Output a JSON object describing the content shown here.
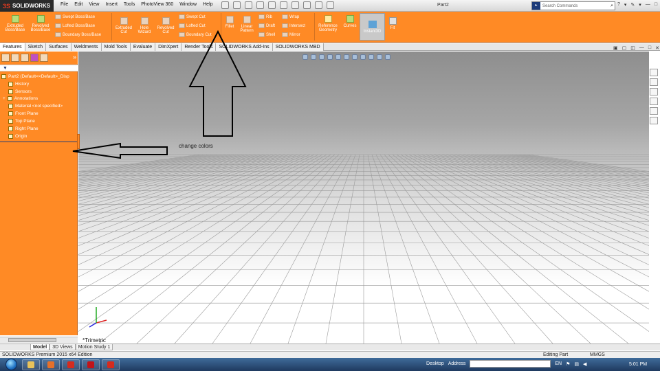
{
  "app": {
    "brand": "SOLIDWORKS",
    "document_title": "Part2"
  },
  "menus": [
    "File",
    "Edit",
    "View",
    "Insert",
    "Tools",
    "PhotoView 360",
    "Window",
    "Help"
  ],
  "search": {
    "placeholder": "Search Commands"
  },
  "help_icons": [
    "?",
    "▾",
    "✎",
    "▾",
    "—",
    "□",
    "✕"
  ],
  "ribbon": {
    "large": [
      {
        "label": "Extruded Boss/Base"
      },
      {
        "label": "Revolved Boss/Base"
      }
    ],
    "small_group1": [
      "Swept Boss/Base",
      "Lofted Boss/Base",
      "Boundary Boss/Base"
    ],
    "cut_group": [
      {
        "label": "Extruded Cut"
      },
      {
        "label": "Hole Wizard"
      },
      {
        "label": "Revolved Cut"
      }
    ],
    "small_group2": [
      "Swept Cut",
      "Lofted Cut",
      "Boundary Cut"
    ],
    "feature_group": [
      {
        "label": "Fillet"
      },
      {
        "label": "Linear Pattern"
      }
    ],
    "small_group3": [
      "Rib",
      "Draft",
      "Shell"
    ],
    "small_group4": [
      "Wrap",
      "Intersect",
      "Mirror"
    ],
    "ref": [
      {
        "label": "Reference Geometry"
      },
      {
        "label": "Curves"
      }
    ],
    "instant3d": "Instant3D",
    "last": "Fit"
  },
  "tabs": [
    "Features",
    "Sketch",
    "Surfaces",
    "Weldments",
    "Mold Tools",
    "Evaluate",
    "DimXpert",
    "Render Tools",
    "SOLIDWORKS Add-Ins",
    "SOLIDWORKS MBD"
  ],
  "feature_tree": [
    "Part2 (Default<<Default>_Disp",
    "History",
    "Sensors",
    "Annotations",
    "Material <not specified>",
    "Front Plane",
    "Top Plane",
    "Right Plane",
    "Origin"
  ],
  "annotation": {
    "text": "change colors"
  },
  "view": {
    "name": "*Trimetric"
  },
  "bottom_tabs": [
    "Model",
    "3D Views",
    "Motion Study 1"
  ],
  "status": {
    "edition": "SOLIDWORKS Premium 2015 x64 Edition",
    "mode": "Editing Part",
    "units": "MMGS"
  },
  "taskbar": {
    "desktop_label": "Desktop",
    "address_label": "Address",
    "lang": "EN",
    "time": "5:01 PM",
    "apps": [
      {
        "name": "explorer",
        "color": "#e8c25a"
      },
      {
        "name": "firefox",
        "color": "#e5702a"
      },
      {
        "name": "solidworks",
        "color": "#d52b1e"
      },
      {
        "name": "acrobat",
        "color": "#c0141a"
      },
      {
        "name": "solidworks-2",
        "color": "#d52b1e"
      }
    ]
  },
  "colors": {
    "panel_orange": "#ff8a25",
    "ribbon_orange": "#ff8a25"
  }
}
